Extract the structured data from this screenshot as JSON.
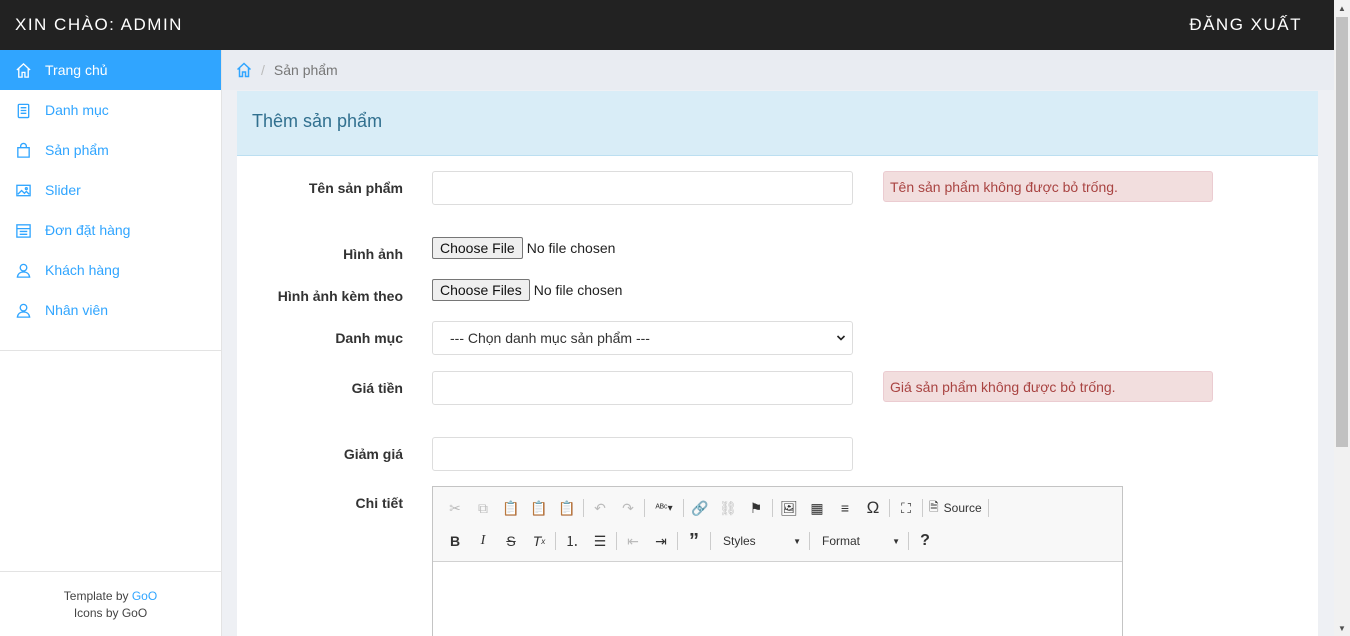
{
  "topbar": {
    "greeting": "XIN CHÀO: ADMIN",
    "logout": "ĐĂNG XUẤT"
  },
  "sidebar": {
    "items": [
      {
        "label": "Trang chủ",
        "icon": "home-icon",
        "active": true
      },
      {
        "label": "Danh mục",
        "icon": "clipboard-icon"
      },
      {
        "label": "Sản phẩm",
        "icon": "shopping-bag-icon"
      },
      {
        "label": "Slider",
        "icon": "image-icon"
      },
      {
        "label": "Đơn đặt hàng",
        "icon": "calendar-icon"
      },
      {
        "label": "Khách hàng",
        "icon": "user-icon"
      },
      {
        "label": "Nhân viên",
        "icon": "user-icon"
      }
    ],
    "footer": {
      "template_prefix": "Template by ",
      "template_link": "GoO",
      "icons_text": "Icons by GoO"
    }
  },
  "breadcrumb": {
    "current": "Sản phẩm"
  },
  "panel": {
    "title": "Thêm sản phẩm"
  },
  "form": {
    "name": {
      "label": "Tên sản phẩm",
      "value": "",
      "error": "Tên sản phẩm không được bỏ trống."
    },
    "image": {
      "label": "Hình ảnh",
      "button": "Choose File",
      "status": "No file chosen"
    },
    "extra_images": {
      "label": "Hình ảnh kèm theo",
      "button": "Choose Files",
      "status": "No file chosen"
    },
    "category": {
      "label": "Danh mục",
      "selected": "--- Chọn danh mục sản phẩm ---"
    },
    "price": {
      "label": "Giá tiền",
      "value": "",
      "error": "Giá sản phẩm không được bỏ trống."
    },
    "discount": {
      "label": "Giảm giá",
      "value": ""
    },
    "detail": {
      "label": "Chi tiết"
    }
  },
  "editor": {
    "source_label": "Source",
    "styles_label": "Styles",
    "format_label": "Format",
    "help_label": "?"
  },
  "colors": {
    "accent": "#30a5ff",
    "topbar": "#222222",
    "panel_head": "#d9edf7",
    "error_bg": "#f2dede",
    "error_text": "#a94442"
  }
}
